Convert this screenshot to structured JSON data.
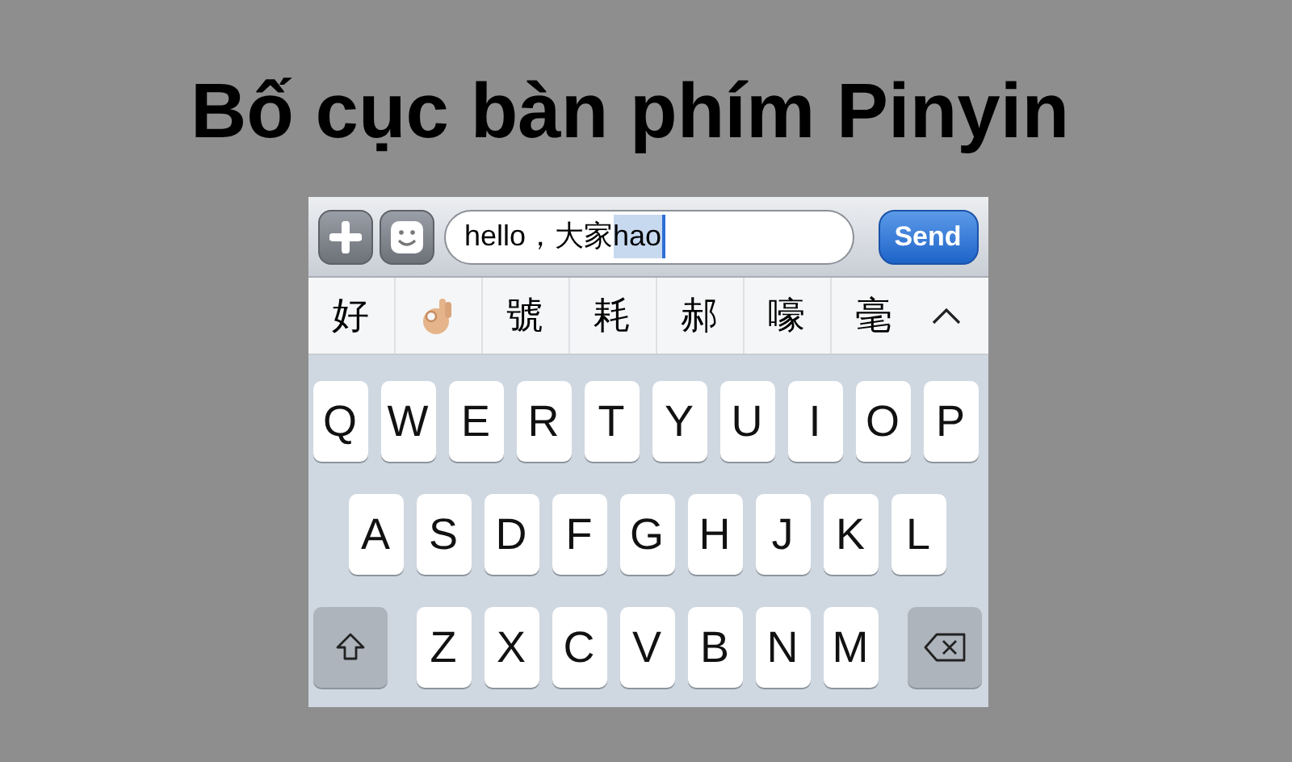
{
  "title": "Bố cục bàn phím Pinyin",
  "input_bar": {
    "message_field": {
      "value": "hello，大家",
      "marked_text": "hao"
    },
    "send_button": "Send"
  },
  "candidates": [
    {
      "kind": "text",
      "label": "好"
    },
    {
      "kind": "emoji"
    },
    {
      "kind": "text",
      "label": "號"
    },
    {
      "kind": "text",
      "label": "耗"
    },
    {
      "kind": "text",
      "label": "郝"
    },
    {
      "kind": "text",
      "label": "嚎"
    },
    {
      "kind": "text",
      "label": "毫"
    }
  ],
  "keyboard": {
    "rows": [
      [
        {
          "kind": "letter",
          "label": "Q"
        },
        {
          "kind": "letter",
          "label": "W"
        },
        {
          "kind": "letter",
          "label": "E"
        },
        {
          "kind": "letter",
          "label": "R"
        },
        {
          "kind": "letter",
          "label": "T"
        },
        {
          "kind": "letter",
          "label": "Y"
        },
        {
          "kind": "letter",
          "label": "U"
        },
        {
          "kind": "letter",
          "label": "I"
        },
        {
          "kind": "letter",
          "label": "O"
        },
        {
          "kind": "letter",
          "label": "P"
        }
      ],
      [
        {
          "kind": "letter",
          "label": "A"
        },
        {
          "kind": "letter",
          "label": "S"
        },
        {
          "kind": "letter",
          "label": "D"
        },
        {
          "kind": "letter",
          "label": "F"
        },
        {
          "kind": "letter",
          "label": "G"
        },
        {
          "kind": "letter",
          "label": "H"
        },
        {
          "kind": "letter",
          "label": "J"
        },
        {
          "kind": "letter",
          "label": "K"
        },
        {
          "kind": "letter",
          "label": "L"
        }
      ],
      [
        {
          "kind": "shift"
        },
        {
          "kind": "letter",
          "label": "Z"
        },
        {
          "kind": "letter",
          "label": "X"
        },
        {
          "kind": "letter",
          "label": "C"
        },
        {
          "kind": "letter",
          "label": "V"
        },
        {
          "kind": "letter",
          "label": "B"
        },
        {
          "kind": "letter",
          "label": "N"
        },
        {
          "kind": "letter",
          "label": "M"
        },
        {
          "kind": "backspace"
        }
      ]
    ]
  }
}
